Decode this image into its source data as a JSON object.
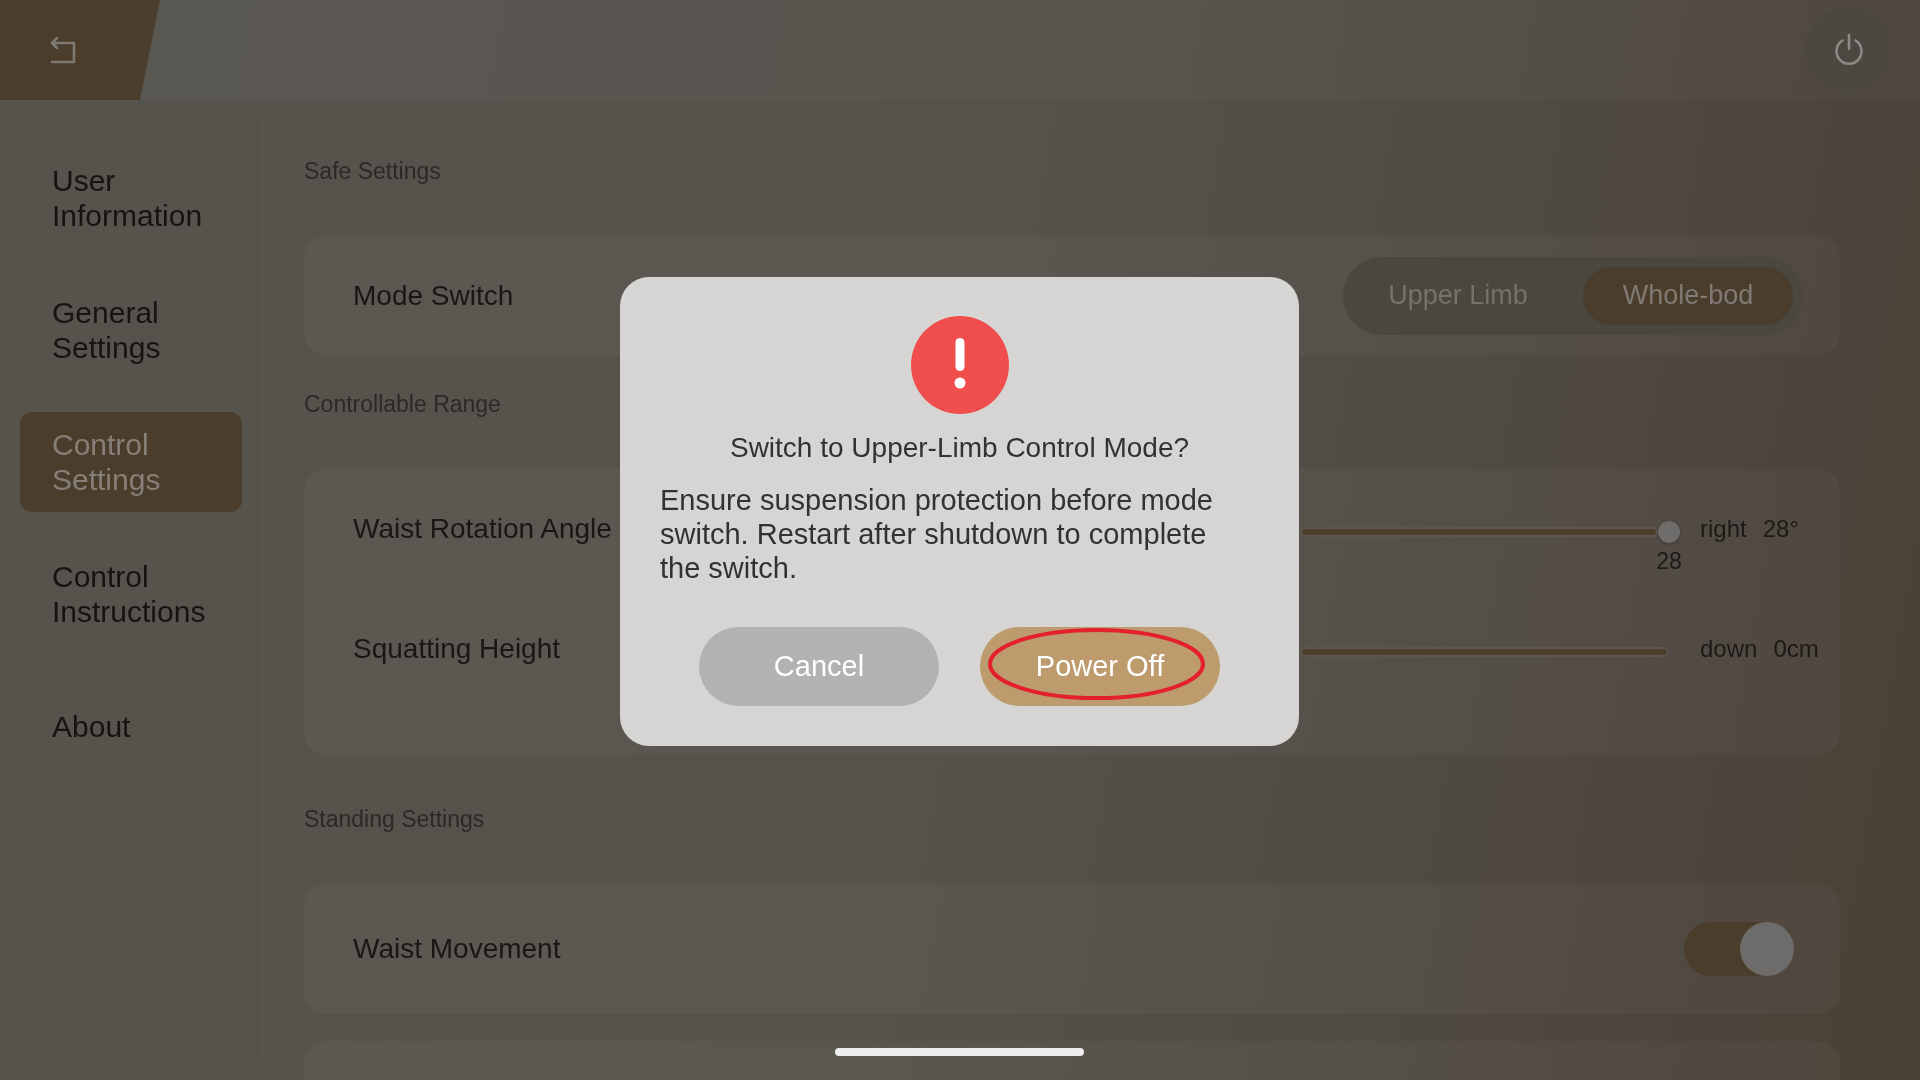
{
  "sidebar": {
    "items": [
      {
        "label": "User Information",
        "selected": false
      },
      {
        "label": "General Settings",
        "selected": false
      },
      {
        "label": "Control Settings",
        "selected": true
      },
      {
        "label": "Control Instructions",
        "selected": false
      },
      {
        "label": "About",
        "selected": false
      }
    ]
  },
  "sections": [
    {
      "title": "Safe Settings",
      "rows": [
        {
          "kind": "segmented",
          "label": "Mode Switch",
          "options": [
            {
              "label": "Upper Limb",
              "selected": false
            },
            {
              "label": "Whole-bod",
              "selected": true
            }
          ]
        }
      ]
    },
    {
      "title": "Controllable Range",
      "rows": [
        {
          "kind": "slider",
          "label": "Waist Rotation Angle",
          "level": 1,
          "handle_label": "28",
          "end_label": "right",
          "end_value": "28°"
        },
        {
          "kind": "slider",
          "label": "Squatting Height",
          "level": 1,
          "end_label": "down",
          "end_value": "0cm"
        }
      ]
    },
    {
      "title": "Standing Settings",
      "rows": [
        {
          "kind": "toggle",
          "label": "Waist Movement",
          "on": true
        }
      ]
    }
  ],
  "dialog": {
    "title": "Switch to Upper-Limb Control Mode?",
    "message": "Ensure suspension protection before mode switch. Restart after shutdown to complete the switch.",
    "buttons": [
      {
        "label": "Cancel",
        "kind": "secondary",
        "circled": false
      },
      {
        "label": "Power Off",
        "kind": "primary",
        "circled": true
      }
    ]
  }
}
